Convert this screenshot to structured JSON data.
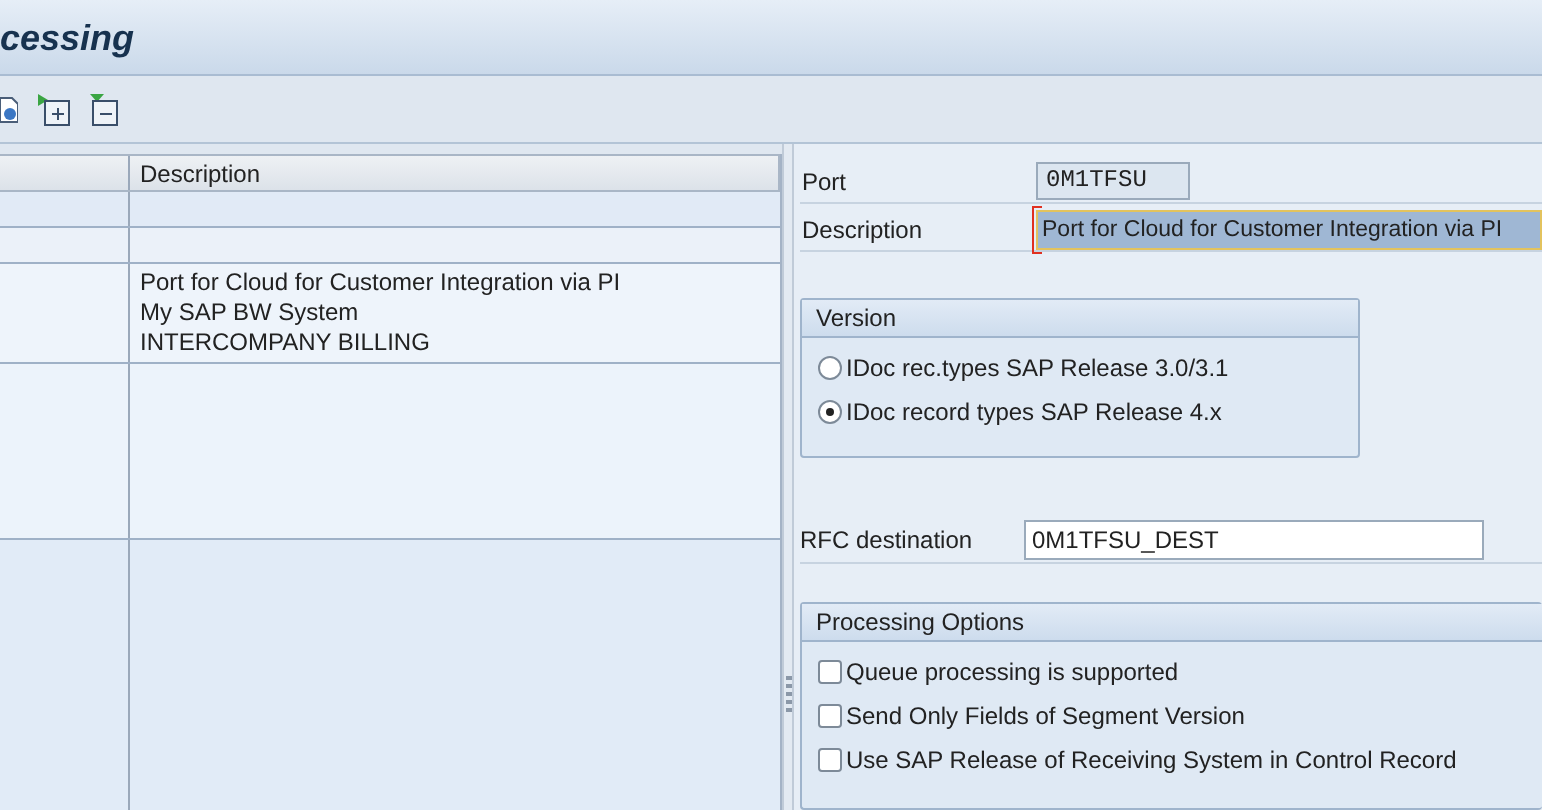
{
  "title": "cessing",
  "table": {
    "columns": [
      "Description"
    ],
    "description_lines": [
      "Port for Cloud for Customer Integration via PI",
      "My SAP BW System",
      "INTERCOMPANY BILLING"
    ]
  },
  "form": {
    "port": {
      "label": "Port",
      "value": "0M1TFSU"
    },
    "description": {
      "label": "Description",
      "value": "Port for Cloud for Customer Integration via PI",
      "focused": true
    },
    "version": {
      "title": "Version",
      "options": [
        {
          "label": "IDoc rec.types SAP Release 3.0/3.1",
          "selected": false
        },
        {
          "label": "IDoc record types SAP Release 4.x",
          "selected": true
        }
      ]
    },
    "rfc_destination": {
      "label": "RFC destination",
      "value": "0M1TFSU_DEST"
    },
    "processing_options": {
      "title": "Processing Options",
      "options": [
        {
          "label": "Queue processing is supported",
          "checked": false
        },
        {
          "label": "Send Only Fields of Segment Version",
          "checked": false
        },
        {
          "label": "Use SAP Release of Receiving System in Control Record",
          "checked": false
        }
      ]
    }
  }
}
